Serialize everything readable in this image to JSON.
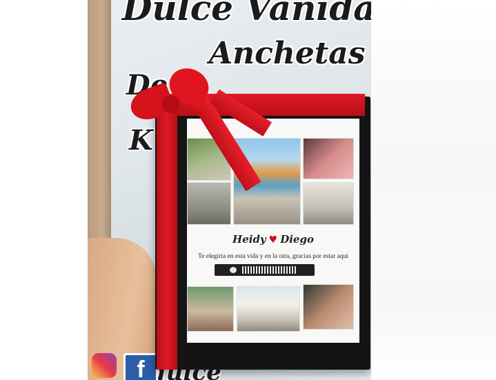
{
  "banner": {
    "line1": "Dulce Vanidad",
    "line2": "Anchetas",
    "line3": "De",
    "line4": "K",
    "bottom": "dulce"
  },
  "frame": {
    "names_left": "Heidy",
    "names_right": "Diego",
    "quote": "Te elegiria en esta vida y en la otra, gracias por estar aqui"
  },
  "social": {
    "facebook_glyph": "f",
    "icons": [
      "instagram-icon",
      "facebook-icon"
    ]
  },
  "colors": {
    "ribbon": "#d6121c",
    "frame": "#141414",
    "heart": "#d0121b"
  }
}
